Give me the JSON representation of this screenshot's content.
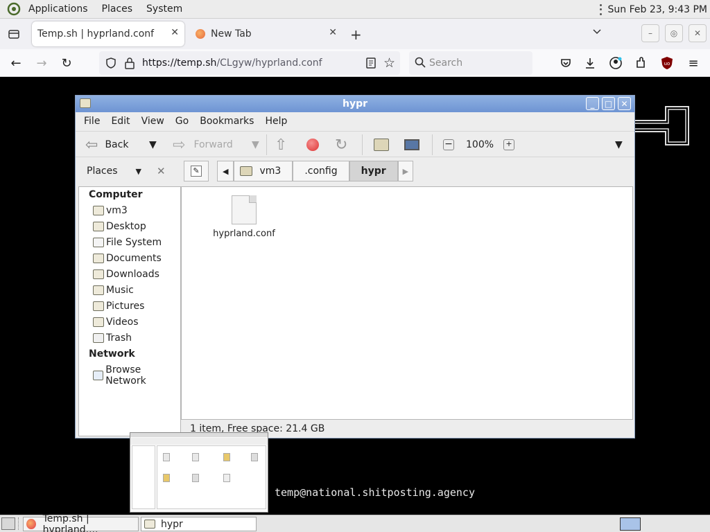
{
  "top_panel": {
    "menus": [
      "Applications",
      "Places",
      "System"
    ],
    "clock": "Sun Feb 23,  9:43 PM"
  },
  "browser": {
    "tabs": [
      {
        "title": "Temp.sh | hyprland.conf",
        "active": true
      },
      {
        "title": "New Tab",
        "active": false
      }
    ],
    "url_host": "https://temp.sh",
    "url_path": "/CLgyw/hyprland.conf",
    "search_placeholder": "Search"
  },
  "file_manager": {
    "title": "hypr",
    "menus": [
      "File",
      "Edit",
      "View",
      "Go",
      "Bookmarks",
      "Help"
    ],
    "toolbar": {
      "back": "Back",
      "forward": "Forward",
      "zoom": "100%"
    },
    "places_label": "Places",
    "breadcrumbs": [
      "vm3",
      ".config",
      "hypr"
    ],
    "sidebar": {
      "computer_heading": "Computer",
      "computer_items": [
        "vm3",
        "Desktop",
        "File System",
        "Documents",
        "Downloads",
        "Music",
        "Pictures",
        "Videos",
        "Trash"
      ],
      "network_heading": "Network",
      "network_items": [
        "Browse Network"
      ]
    },
    "files": [
      {
        "name": "hyprland.conf"
      }
    ],
    "status": "1 item, Free space: 21.4 GB"
  },
  "terminal_text": "temp@national.shitposting.agency",
  "taskbar": {
    "tasks": [
      "Temp.sh | hyprland....",
      "hypr"
    ]
  }
}
